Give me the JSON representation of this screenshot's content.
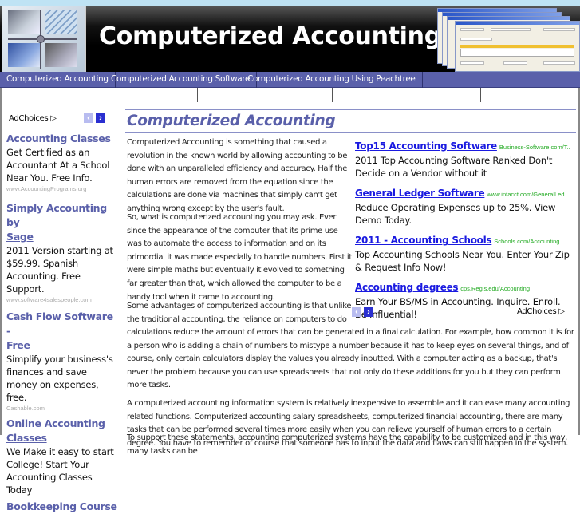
{
  "header": {
    "site_title": "Computerized Accounting",
    "logo_image": "office-collage-image",
    "screens_image": "accounting-software-screenshot"
  },
  "nav": {
    "items": [
      {
        "label": "Computerized Accounting"
      },
      {
        "label": "Computerized Accounting Software"
      },
      {
        "label": "Computerized Accounting Using Peachtree"
      }
    ]
  },
  "left_ads": {
    "adchoices_label": "AdChoices",
    "adchoices_icon": "adchoices-triangle-icon",
    "prev_icon": "chevron-left-icon",
    "next_icon": "chevron-right-icon",
    "items": [
      {
        "title": "Accounting Classes",
        "desc": "Get Certified as an Accountant At a School Near You. Free Info.",
        "url": "www.AccountingPrograms.org"
      },
      {
        "title_line1": "Simply Accounting by",
        "title_line2": "Sage",
        "desc": "2011 Version starting at $59.99. Spanish Accounting. Free Support.",
        "url": "www.software4salespeople.com"
      },
      {
        "title_line1": "Cash Flow Software -",
        "title_line2": "Free",
        "desc": "Simplify your business's finances and save money on expenses, free.",
        "url": "Cashable.com"
      },
      {
        "title_line1": "Online Accounting",
        "title_line2": "Classes",
        "desc": "We Make it easy to start College! Start Your Accounting Classes Today"
      },
      {
        "title": "Bookkeeping Course"
      }
    ]
  },
  "main": {
    "title": "Computerized Accounting",
    "paragraphs": [
      "Computerized Accounting is something that caused a revolution in the known world by allowing accounting to be done with an unparalleled efficiency and accuracy. Half the human errors are removed from the equation since the calculations are done via machines that simply can't get anything wrong except by the user's fault.",
      "So, what is computerized accounting you may ask. Ever since the appearance of the computer that its prime use was to automate the access to information and on its primordial it was made especially to handle numbers. First it were simple maths but eventually it evolved to something far greater than that, which allowed the computer to be a handy tool when it came to accounting.",
      "Some advantages of computerized accounting is that unlike the traditional accounting, the reliance on computers to do",
      "calculations reduce the amount of errors that can be generated in a final calculation. For example, how common it is for a person who is adding a chain of numbers to mistype a number because it has to keep eyes on several things, and of course, only certain calculators display the values you already inputted. With a computer acting as a backup, that's never the problem because you can use spreadsheets that not only do these additions for you but they can perform more tasks.",
      "A computerized accounting information system is relatively inexpensive to assemble and it can ease many accounting related functions. Computerized accounting salary spreadsheets, computerized financial accounting, there are many tasks that can be performed several times more easily when you can relieve yourself of human errors to a certain degree. You have to remember of course that someone has to input the data and flaws can still happen in the system.",
      "To support these statements, accounting computerized systems have the capability to be customized and in this way, many tasks can be"
    ]
  },
  "right_ads": {
    "adchoices_label": "AdChoices",
    "items": [
      {
        "title": "Top15 Accounting Software",
        "url": "Business-Software.com/T..",
        "desc": "2011 Top Accounting Software Ranked Don't Decide on a Vendor without it"
      },
      {
        "title": "General Ledger Software",
        "url": "www.intacct.com/GeneralLed...",
        "desc": "Reduce Operating Expenses up to 25%. View Demo Today."
      },
      {
        "title": "2011 - Accounting Schools",
        "url": "Schools.com/Accounting",
        "desc": "Top Accounting Schools Near You. Enter Your Zip & Request Info Now!"
      },
      {
        "title": "Accounting degrees",
        "url": "cps.Regis.edu/Accounting",
        "desc": "Earn Your BS/MS in Accounting. Inquire. Enroll. Be Influential!"
      }
    ]
  },
  "colors": {
    "nav_bg": "#5a60aa",
    "heading": "#5a60aa",
    "ad_link": "#1a1ae0",
    "ad_url": "#22aa22",
    "top_strip": "#bfe3f4"
  }
}
